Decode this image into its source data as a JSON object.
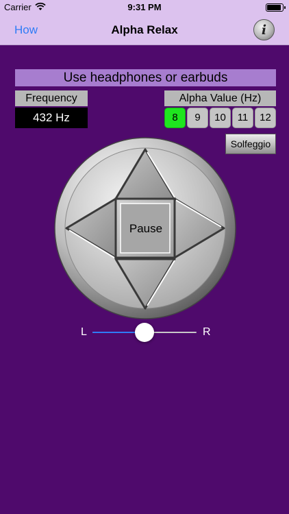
{
  "status_bar": {
    "carrier": "Carrier",
    "time": "9:31 PM",
    "wifi_icon": "wifi-icon",
    "battery_icon": "battery-icon"
  },
  "nav": {
    "left_button": "How",
    "title": "Alpha Relax",
    "info_glyph": "i",
    "info_icon": "info-icon"
  },
  "banner": "Use headphones or earbuds",
  "frequency": {
    "label": "Frequency",
    "value": "432 Hz"
  },
  "alpha": {
    "label": "Alpha Value (Hz)",
    "options": [
      "8",
      "9",
      "10",
      "11",
      "12"
    ],
    "selected": "8"
  },
  "solfeggio_label": "Solfeggio",
  "control_pad": {
    "center_label": "Pause"
  },
  "balance": {
    "left_label": "L",
    "right_label": "R",
    "value": 0.5
  },
  "colors": {
    "background": "#4f0a6c",
    "nav_bar": "#dcc2ee",
    "banner": "#a77dcf",
    "accent_blue": "#2f7cf6",
    "selected_green": "#1fe51f"
  }
}
